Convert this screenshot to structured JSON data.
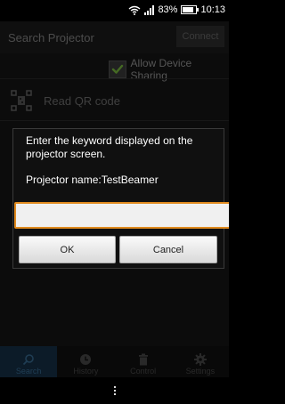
{
  "status_bar": {
    "battery": "83%",
    "time": "10:13",
    "battery_level": 0.83
  },
  "app_bar": {
    "title": "Search Projector",
    "connect_label": "Connect"
  },
  "sharing": {
    "label": "Allow Device Sharing",
    "checked": true
  },
  "qr": {
    "label": "Read QR code"
  },
  "dialog": {
    "message": "Enter the keyword displayed on the projector screen.",
    "projector_name": "Projector name:TestBeamer",
    "keyword_value": "",
    "ok_label": "OK",
    "cancel_label": "Cancel"
  },
  "tabs": [
    {
      "label": "Search",
      "icon": "search-icon",
      "active": true
    },
    {
      "label": "History",
      "icon": "clock-icon",
      "active": false
    },
    {
      "label": "Control",
      "icon": "trash-icon",
      "active": false
    },
    {
      "label": "Settings",
      "icon": "gear-icon",
      "active": false
    }
  ],
  "colors": {
    "accent_input_border": "#e08a1e",
    "check_green": "#7fc241",
    "active_tab": "#17324a"
  }
}
